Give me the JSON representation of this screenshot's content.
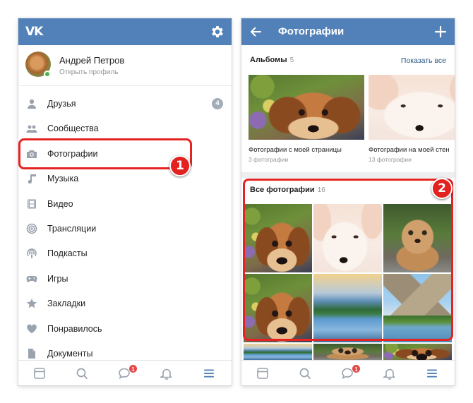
{
  "left_screen": {
    "header": {
      "logo": "VK",
      "settings_icon": "gear-icon"
    },
    "profile": {
      "name": "Андрей Петров",
      "subtitle": "Открыть профиль"
    },
    "menu": [
      {
        "label": "Друзья",
        "icon": "person-icon",
        "badge": "4"
      },
      {
        "label": "Сообщества",
        "icon": "group-icon"
      },
      {
        "label": "Фотографии",
        "icon": "camera-icon"
      },
      {
        "label": "Музыка",
        "icon": "music-note-icon"
      },
      {
        "label": "Видео",
        "icon": "film-icon"
      },
      {
        "label": "Трансляции",
        "icon": "broadcast-icon"
      },
      {
        "label": "Подкасты",
        "icon": "podcast-icon"
      },
      {
        "label": "Игры",
        "icon": "gamepad-icon"
      },
      {
        "label": "Закладки",
        "icon": "star-icon"
      },
      {
        "label": "Понравилось",
        "icon": "heart-icon"
      },
      {
        "label": "Документы",
        "icon": "document-icon"
      }
    ]
  },
  "right_screen": {
    "header": {
      "title": "Фотографии",
      "back_icon": "arrow-left-icon",
      "add_icon": "plus-icon"
    },
    "albums_section": {
      "title": "Альбомы",
      "count": "5",
      "show_all": "Показать все"
    },
    "albums": [
      {
        "title": "Фотографии с моей страницы",
        "subtitle": "3 фотографии"
      },
      {
        "title": "Фотографии на моей стен",
        "subtitle": "13 фотографии"
      }
    ],
    "all_photos_section": {
      "title": "Все фотографии",
      "count": "16"
    }
  },
  "tabbar": {
    "items": [
      "news-icon",
      "search-icon",
      "messages-icon",
      "bell-icon",
      "menu-icon"
    ],
    "messages_badge": "1"
  },
  "callouts": [
    "1",
    "2"
  ],
  "colors": {
    "header": "#5181b8",
    "accent_link": "#2a5885",
    "callout": "#e52323",
    "badge": "#e64646"
  }
}
